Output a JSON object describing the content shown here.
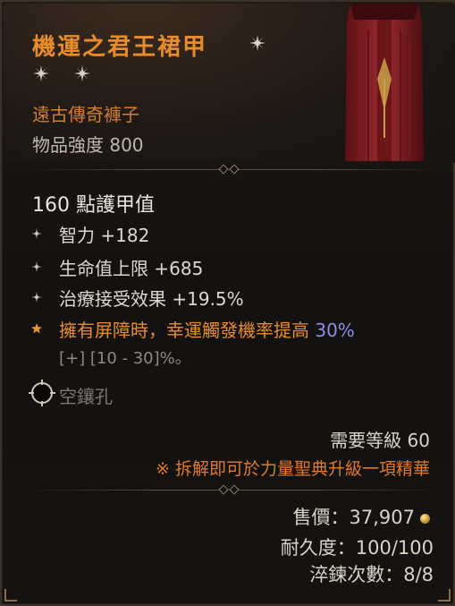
{
  "item": {
    "name": "機運之君王裙甲",
    "type": "遠古傳奇褲子",
    "power": "物品強度 800",
    "armor": "160 點護甲值"
  },
  "affixes": [
    {
      "text": "智力 +182",
      "icon": "sparkle-icon"
    },
    {
      "text": "生命值上限 +685",
      "icon": "sparkle-icon"
    },
    {
      "text": "治療接受效果 +19.5%",
      "icon": "sparkle-icon"
    }
  ],
  "legendary": {
    "icon": "legendary-star-icon",
    "text": "擁有屏障時，幸運觸發機率提高 ",
    "value": "30%",
    "range": "[+] [10 - 30]%。"
  },
  "socket": {
    "label": "空鑲孔",
    "icon": "empty-socket-icon"
  },
  "requirements": {
    "level": "需要等級 60",
    "salvage": "※ 拆解即可於力量聖典升級一項精華"
  },
  "footer": {
    "sell": "售價：37,907",
    "durability": "耐久度：100/100",
    "temper": "淬鍊次數：8/8",
    "gold_icon": "gold-coin-icon"
  },
  "colors": {
    "legendary": "#e88d2b",
    "text": "#ddd8cf",
    "value_highlight": "#8e8ce8"
  }
}
